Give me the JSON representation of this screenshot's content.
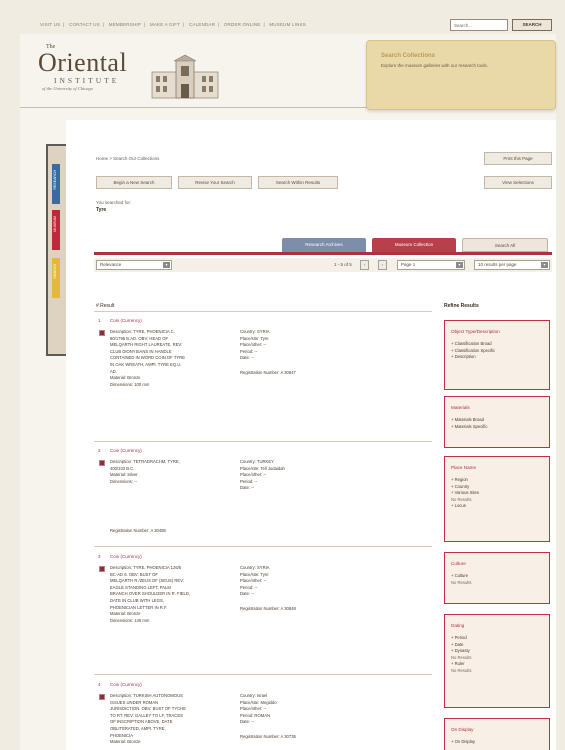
{
  "top_nav": {
    "items": [
      "VISIT US",
      "CONTACT US",
      "MEMBERSHIP",
      "MAKE A GIFT",
      "CALENDAR",
      "ORDER ONLINE",
      "MUSEUM LINKS"
    ],
    "search_placeholder": "Search...",
    "search_button": "SEARCH"
  },
  "header": {
    "logo_the": "The",
    "logo_main": "Oriental",
    "logo_sub": "INSTITUTE",
    "logo_tag": "of the University of Chicago",
    "promo_title": "Search Collections",
    "promo_text": "Explore the museum galleries with our research tools."
  },
  "side_tabs": [
    "RESEARCH",
    "MUSEUM",
    "SEARCH"
  ],
  "breadcrumb": "Home > Search Our Collections",
  "actions": {
    "print": "Print this Page",
    "new_search": "Begin a New Search",
    "revise": "Revise Your Search",
    "within": "Search Within Results",
    "view_selections": "View Selections"
  },
  "you_searched_label": "You searched for:",
  "search_term": "Tyre",
  "tabs": [
    "Research Archives",
    "Museum Collection",
    "Search All"
  ],
  "controls": {
    "sort": "Relevance",
    "count": "1 - 5 of 5",
    "page": "Page 1",
    "per_page": "10 results per page"
  },
  "results_heading": "#    Result",
  "refine_heading": "Refine Results",
  "results": [
    {
      "num": "1",
      "title": "Coin (Currency)",
      "desc": [
        "Description: TYRE, PHOENICIA C.",
        "90/1795 B.AD. OBV: HEAD OF",
        "MELQARTH RIGHT LAUREATE, REV:",
        "CLUB DIONYSIANS IN HANDLE",
        "CONTAINED IN WORD COIN OF TYRE",
        "IN OAK WREATH, AMPI. TYRE EQ.U.",
        "AD."
      ],
      "material": "Material: Bronze",
      "dimensions": "Dimensions: 100 mm",
      "meta": [
        "Country: SYRIA",
        "Place/site: Tyre",
        "Place/other: --",
        "Period: --",
        "Date: --"
      ],
      "reg": "Registration Number: A 30847"
    },
    {
      "num": "2",
      "title": "Coin (Currency)",
      "desc": [
        "Description: TETRADRACHM, TYRE,",
        "400/333 B.C."
      ],
      "material": "Material: Silver",
      "dimensions": "Dimensions: --",
      "meta": [
        "Country: TURKEY",
        "Place/site: Tell Judaidah",
        "Place/other: --",
        "Period: --",
        "Date: --"
      ],
      "reg": "Registration Number: A 30485"
    },
    {
      "num": "3",
      "title": "Coin (Currency)",
      "desc": [
        "Description: TYRE, PHOENICIA 126/5",
        "BC-AD 6. OBV: BUST OF",
        "MELQARTH R./ZEUS OF (SEUS) REV:",
        "EAGLE STANDING LEFT, PALM",
        "BRANCH OVER SHOULDER IN R. FIELD,",
        "DATE IN CLUB WITH LEGS,",
        "PHOENICIAN LETTER IN R.F."
      ],
      "material": "Material: Bronze",
      "dimensions": "Dimensions: 140 mm",
      "meta": [
        "Country: SYRIA",
        "Place/site: Tyre",
        "Place/other: --",
        "Period: --",
        "Date: --"
      ],
      "reg": "Registration Number: A 30848"
    },
    {
      "num": "4",
      "title": "Coin (Currency)",
      "desc": [
        "Description: TURKISH AUTONOMOUS",
        "ISSUES UNDER ROMAN",
        "JURISDICTION. OBV: BUST OF TYCHE",
        "TO RT. REV: GALLEY TO LF, TRACES",
        "OF INSCRIPTION ABOVE, DATE",
        "OBLITERATED, AMPI. TYRE,",
        "PHOENICIA"
      ],
      "material": "Material: Bronze",
      "dimensions": "",
      "meta": [
        "Country: Israel",
        "Place/site: Megiddo",
        "Place/other: --",
        "Period: ROMAN",
        "Date: --"
      ],
      "reg": "Registration Number: A 30735"
    }
  ],
  "refine": [
    {
      "title": "Object Type/Description",
      "items": [
        "+ Classification Broad",
        "+ Classification Specific",
        "+ Description"
      ]
    },
    {
      "title": "Materials",
      "items": [
        "+ Materials Broad",
        "+ Materials Specific"
      ]
    },
    {
      "title": "Place Name",
      "items": [
        "+ Region",
        "+ Country",
        "+ Various Sites",
        "No Results",
        "+ Locus"
      ]
    },
    {
      "title": "Culture",
      "items": [
        "+ Culture",
        "No Results"
      ]
    },
    {
      "title": "Dating",
      "items": [
        "+ Period",
        "+ Date",
        "+ Dynasty",
        "No Results",
        "+ Ruler",
        "No Results"
      ]
    },
    {
      "title": "On Display",
      "items": [
        "+ On Display"
      ]
    }
  ],
  "colors": {
    "accent_red": "#b0303e",
    "tab_blue": "#7c8eaa",
    "promo_gold": "#ead9a8",
    "paper": "#f7f4ee"
  }
}
